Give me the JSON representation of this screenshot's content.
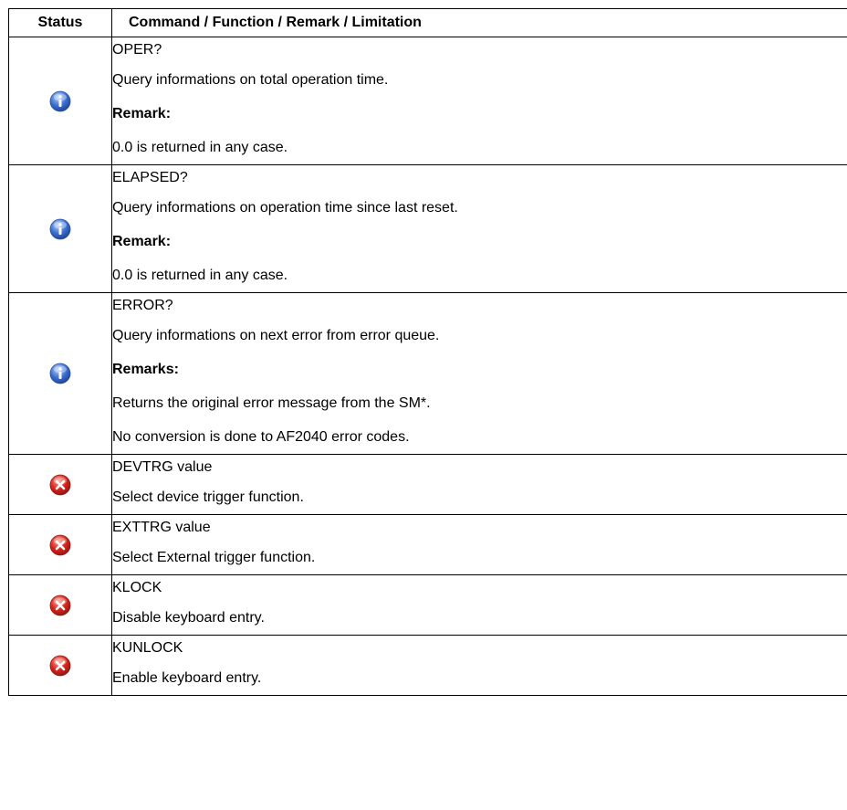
{
  "header": {
    "status": "Status",
    "command": "Command / Function / Remark / Limitation"
  },
  "rows": [
    {
      "status": "info-icon",
      "lines": [
        {
          "text": "OPER?",
          "bold": false
        },
        {
          "text": "Query informations on total operation time.",
          "bold": false
        },
        {
          "text": "Remark:",
          "bold": true
        },
        {
          "text": "0.0 is returned in any case.",
          "bold": false
        }
      ]
    },
    {
      "status": "info-icon",
      "lines": [
        {
          "text": "ELAPSED?",
          "bold": false
        },
        {
          "text": "Query informations on operation time since last reset.",
          "bold": false
        },
        {
          "text": "Remark:",
          "bold": true
        },
        {
          "text": "0.0 is returned in any case.",
          "bold": false
        }
      ]
    },
    {
      "status": "info-icon",
      "lines": [
        {
          "text": "ERROR?",
          "bold": false
        },
        {
          "text": "Query informations on next error from error queue.",
          "bold": false
        },
        {
          "text": "Remarks:",
          "bold": true
        },
        {
          "text": "Returns the original error message from the SM*.",
          "bold": false
        },
        {
          "text": "No conversion is done to AF2040 error codes.",
          "bold": false
        }
      ]
    },
    {
      "status": "error-icon",
      "lines": [
        {
          "text": "DEVTRG value",
          "bold": false
        },
        {
          "text": "Select device trigger function.",
          "bold": false
        }
      ]
    },
    {
      "status": "error-icon",
      "lines": [
        {
          "text": "EXTTRG value",
          "bold": false
        },
        {
          "text": "Select External trigger function.",
          "bold": false
        }
      ]
    },
    {
      "status": "error-icon",
      "lines": [
        {
          "text": "KLOCK",
          "bold": false
        },
        {
          "text": "Disable keyboard entry.",
          "bold": false
        }
      ]
    },
    {
      "status": "error-icon",
      "lines": [
        {
          "text": "KUNLOCK",
          "bold": false
        },
        {
          "text": "Enable keyboard entry.",
          "bold": false
        }
      ]
    }
  ],
  "colors": {
    "info": "#3b6fd1",
    "error": "#d8241c"
  }
}
